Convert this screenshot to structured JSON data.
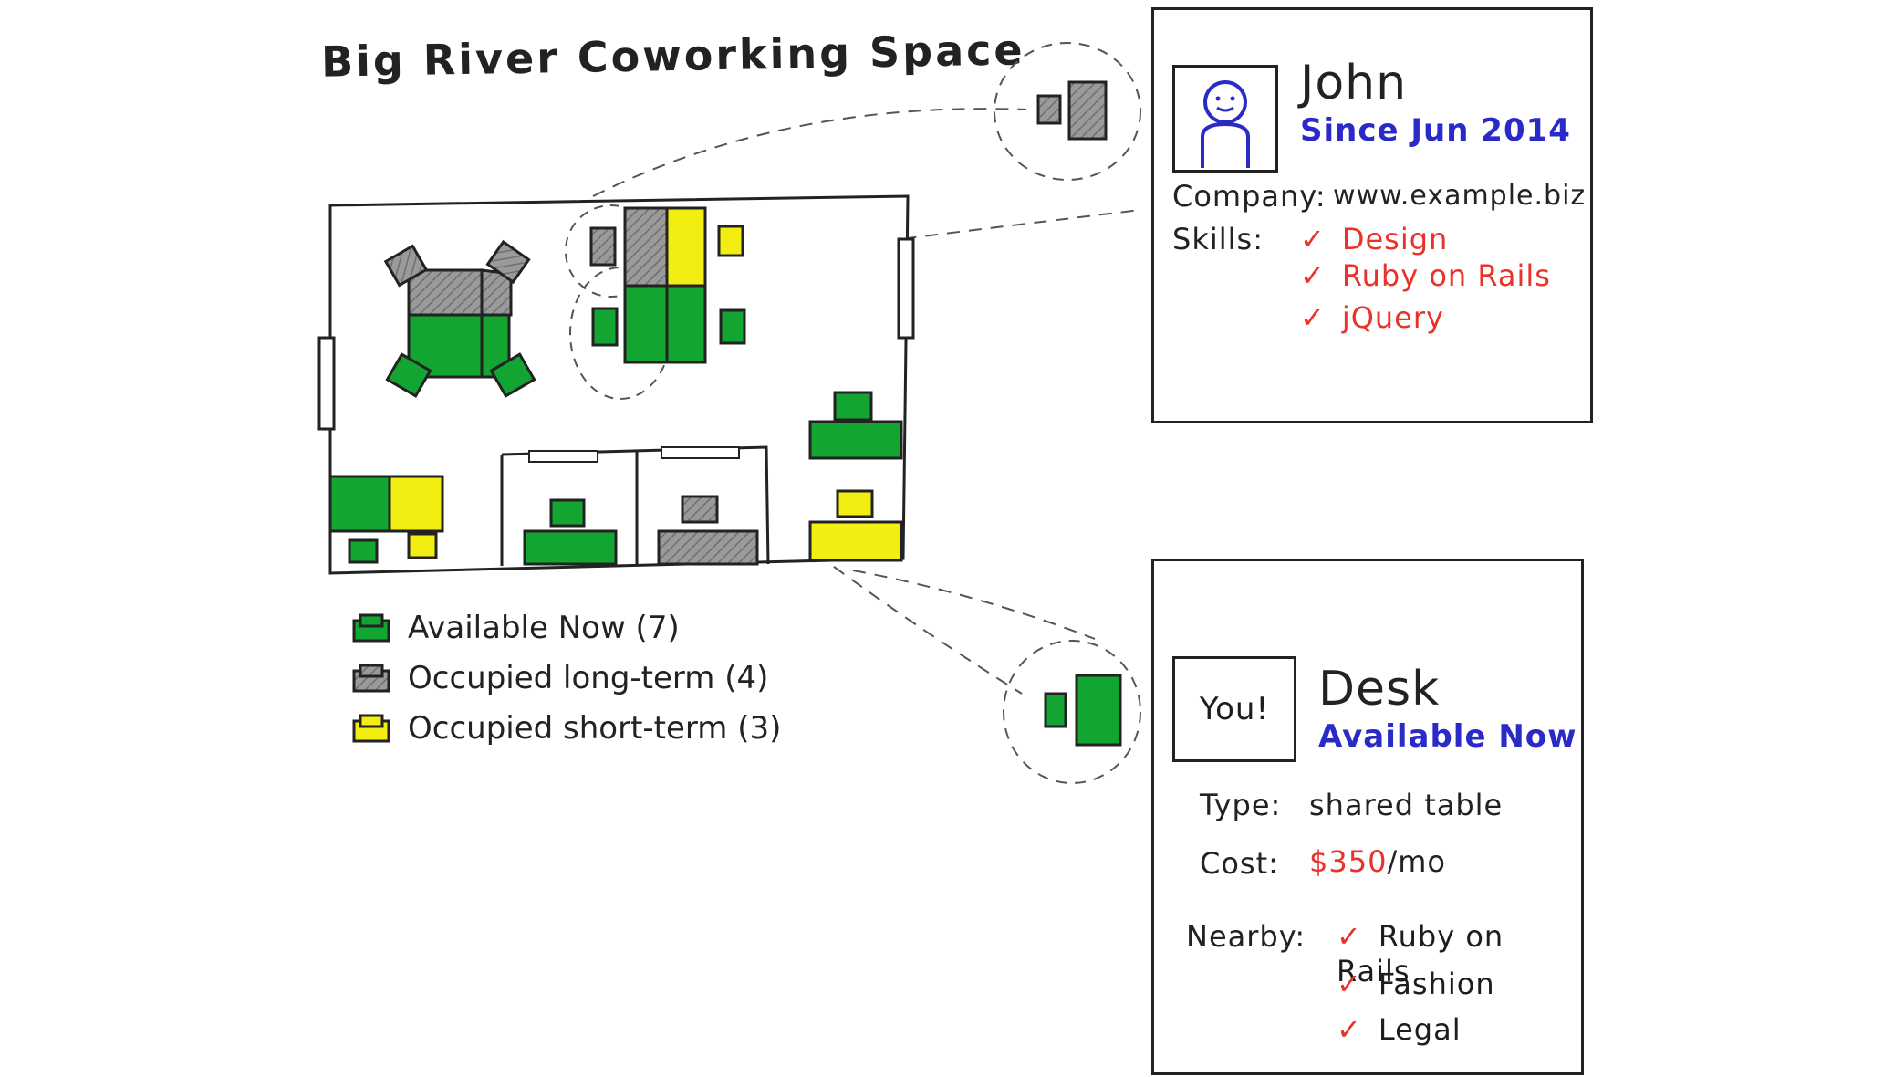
{
  "title": "Big River Coworking Space",
  "legend": [
    {
      "label": "Available Now (7)",
      "color": "#13a532"
    },
    {
      "label": "Occupied long-term (4)",
      "color": "#9a9a9a"
    },
    {
      "label": "Occupied short-term (3)",
      "color": "#f2ee12"
    }
  ],
  "member_card": {
    "name": "John",
    "since": "Since Jun 2014",
    "company_label": "Company:",
    "company_value": "www.example.biz",
    "skills_label": "Skills:",
    "skills": [
      "Design",
      "Ruby on Rails",
      "jQuery"
    ]
  },
  "desk_card": {
    "you_label": "You!",
    "name": "Desk",
    "status": "Available Now",
    "type_label": "Type:",
    "type_value": "shared table",
    "cost_label": "Cost:",
    "cost_value": "$350",
    "cost_unit": "/mo",
    "nearby_label": "Nearby:",
    "nearby": [
      "Ruby on Rails",
      "Fashion",
      "Legal"
    ]
  },
  "colors": {
    "available": "#13a532",
    "long_term": "#9a9a9a",
    "short_term": "#f2ee12",
    "accent_blue": "#2a2ac8",
    "accent_red": "#e8322a"
  }
}
